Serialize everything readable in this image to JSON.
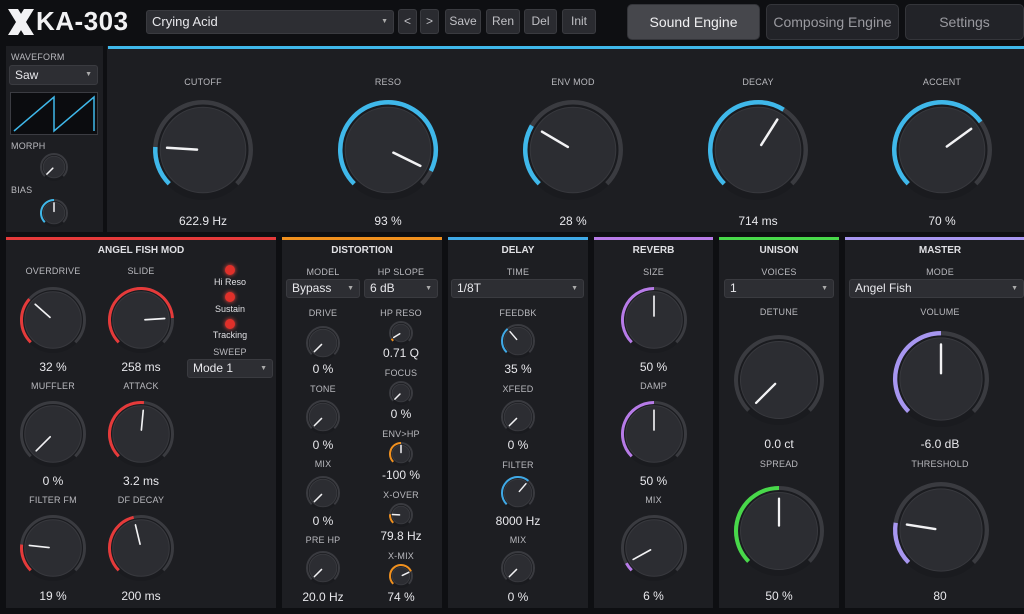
{
  "app": {
    "title": "KA-303"
  },
  "toolbar": {
    "preset": "Crying Acid",
    "prev": "<",
    "next": ">",
    "save": "Save",
    "rename": "Ren",
    "delete": "Del",
    "init": "Init"
  },
  "tabs": [
    {
      "label": "Sound Engine",
      "active": true
    },
    {
      "label": "Composing Engine",
      "active": false
    },
    {
      "label": "Settings",
      "active": false
    }
  ],
  "osc": {
    "waveform_label": "WAVEFORM",
    "waveform": "Saw",
    "morph_label": "MORPH",
    "bias_label": "BIAS"
  },
  "filter": {
    "cutoff_label": "CUTOFF",
    "cutoff": "622.9 Hz",
    "reso_label": "RESO",
    "reso": "93 %",
    "envmod_label": "ENV MOD",
    "envmod": "28 %",
    "decay_label": "DECAY",
    "decay": "714 ms",
    "accent_label": "ACCENT",
    "accent": "70 %"
  },
  "angel": {
    "title": "ANGEL FISH MOD",
    "overdrive_label": "OVERDRIVE",
    "overdrive": "32 %",
    "slide_label": "SLIDE",
    "slide": "258 ms",
    "muffler_label": "MUFFLER",
    "muffler": "0 %",
    "attack_label": "ATTACK",
    "attack": "3.2 ms",
    "filterfm_label": "FILTER FM",
    "filterfm": "19 %",
    "dfdecay_label": "DF DECAY",
    "dfdecay": "200 ms",
    "hireso": "Hi Reso",
    "sustain": "Sustain",
    "tracking": "Tracking",
    "sweep_label": "SWEEP",
    "sweep": "Mode 1"
  },
  "distortion": {
    "title": "DISTORTION",
    "model_label": "MODEL",
    "model": "Bypass",
    "hpslope_label": "HP SLOPE",
    "hpslope": "6 dB",
    "drive_label": "DRIVE",
    "drive": "0 %",
    "hpreso_label": "HP RESO",
    "hpreso": "0.71 Q",
    "tone_label": "TONE",
    "tone": "0 %",
    "focus_label": "FOCUS",
    "focus": "0 %",
    "envhp_label": "ENV>HP",
    "envhp": "-100 %",
    "mix_label": "MIX",
    "mix": "0 %",
    "xover_label": "X-OVER",
    "xover": "79.8 Hz",
    "prehp_label": "PRE HP",
    "prehp": "20.0 Hz",
    "xmix_label": "X-MIX",
    "xmix": "74 %"
  },
  "delay": {
    "title": "DELAY",
    "time_label": "TIME",
    "time": "1/8T",
    "feedbk_label": "FEEDBK",
    "feedbk": "35 %",
    "xfeed_label": "XFEED",
    "xfeed": "0 %",
    "filter_label": "FILTER",
    "filter": "8000 Hz",
    "mix_label": "MIX",
    "mix": "0 %"
  },
  "reverb": {
    "title": "REVERB",
    "size_label": "SIZE",
    "size": "50 %",
    "damp_label": "DAMP",
    "damp": "50 %",
    "mix_label": "MIX",
    "mix": "6 %"
  },
  "unison": {
    "title": "UNISON",
    "voices_label": "VOICES",
    "voices": "1",
    "detune_label": "DETUNE",
    "detune": "0.0 ct",
    "spread_label": "SPREAD",
    "spread": "50 %"
  },
  "master": {
    "title": "MASTER",
    "mode_label": "MODE",
    "mode": "Angel Fish",
    "volume_label": "VOLUME",
    "volume": "-6.0 dB",
    "threshold_label": "THRESHOLD",
    "threshold": "80"
  },
  "colors": {
    "filter": "#3fb8ea",
    "angel": "#e53a3a",
    "distortion": "#f0901e",
    "delay": "#3fa9e6",
    "reverb": "#b77be8",
    "unison": "#48d84a",
    "master": "#a796f0"
  }
}
